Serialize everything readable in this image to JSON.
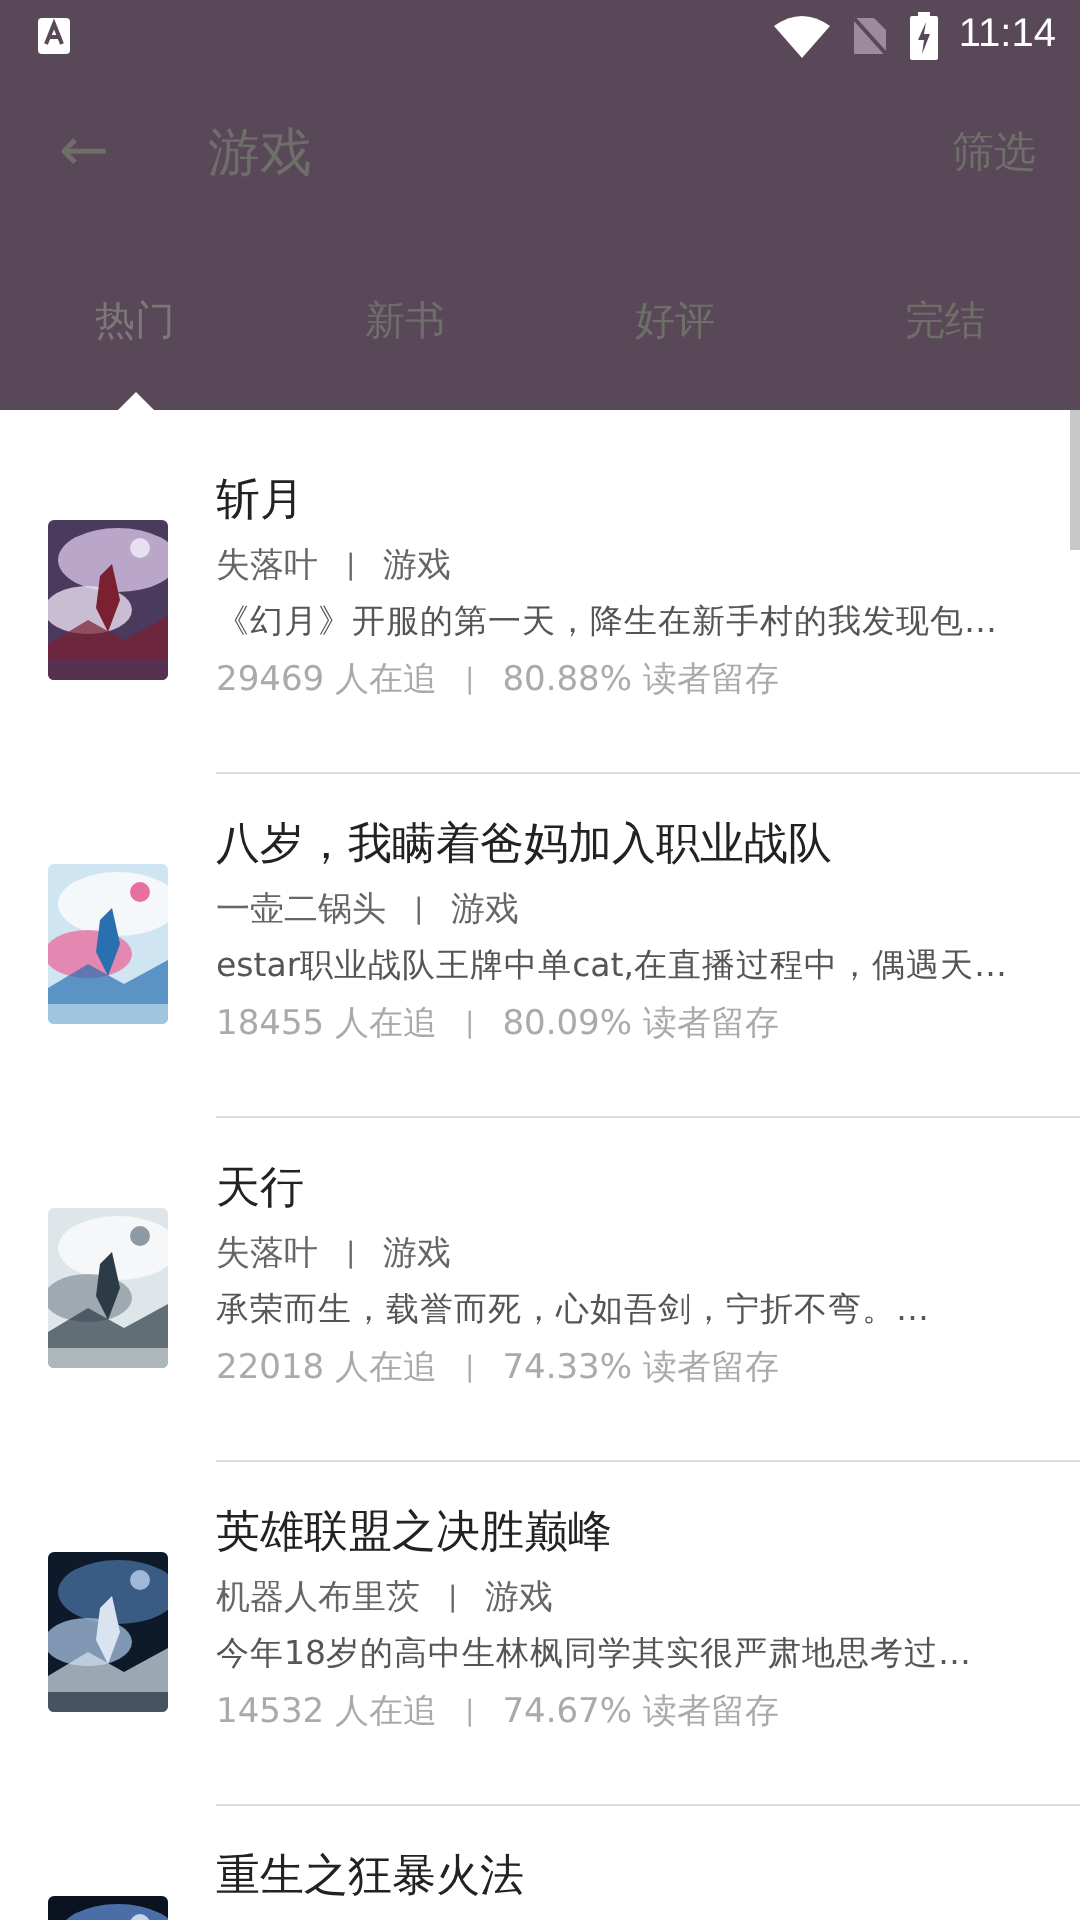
{
  "status_bar": {
    "time": "11:14"
  },
  "toolbar": {
    "back": "←",
    "title": "游戏",
    "action": "筛选"
  },
  "tabs": [
    {
      "label": "热门",
      "selected": true
    },
    {
      "label": "新书",
      "selected": false
    },
    {
      "label": "好评",
      "selected": false
    },
    {
      "label": "完结",
      "selected": false
    }
  ],
  "books": [
    {
      "title": "斩月",
      "author": "失落叶",
      "separator": "|",
      "category": "游戏",
      "description": "《幻月》开服的第一天，降生在新手村的我发现包…",
      "followers": "29469 人在追",
      "stats_separator": "|",
      "retention": "80.88% 读者留存"
    },
    {
      "title": "八岁，我瞒着爸妈加入职业战队",
      "author": "一壶二锅头",
      "separator": "|",
      "category": "游戏",
      "description": "estar职业战队王牌中单cat,在直播过程中，偶遇天…",
      "followers": "18455 人在追",
      "stats_separator": "|",
      "retention": "80.09% 读者留存"
    },
    {
      "title": "天行",
      "author": "失落叶",
      "separator": "|",
      "category": "游戏",
      "description": "承荣而生，载誉而死，心如吾剑，宁折不弯。…",
      "followers": "22018 人在追",
      "stats_separator": "|",
      "retention": "74.33% 读者留存"
    },
    {
      "title": "英雄联盟之决胜巅峰",
      "author": "机器人布里茨",
      "separator": "|",
      "category": "游戏",
      "description": "今年18岁的高中生林枫同学其实很严肃地思考过…",
      "followers": "14532 人在追",
      "stats_separator": "|",
      "retention": "74.67% 读者留存"
    },
    {
      "title": "重生之狂暴火法"
    }
  ]
}
